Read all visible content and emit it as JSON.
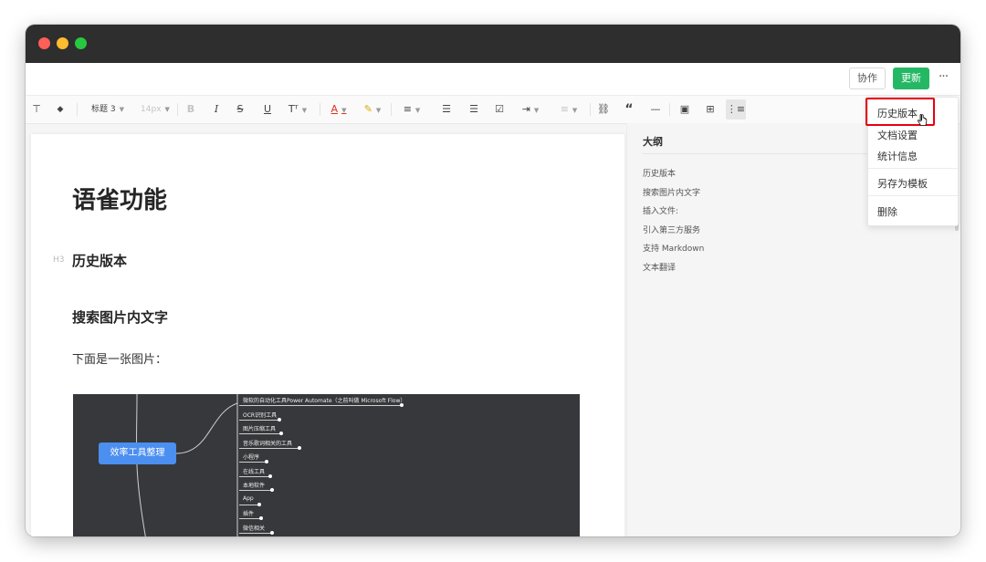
{
  "topbar": {
    "collab_label": "协作",
    "update_label": "更新",
    "more_label": "···"
  },
  "toolbar": {
    "items": [
      {
        "name": "format-painter-icon",
        "glyph": "⊤"
      },
      {
        "name": "eraser-icon",
        "glyph": "◆"
      },
      {
        "name": "heading-select",
        "glyph": "标题 3"
      },
      {
        "name": "font-size-select",
        "glyph": "14px"
      },
      {
        "name": "bold-icon",
        "glyph": "B"
      },
      {
        "name": "italic-icon",
        "glyph": "I"
      },
      {
        "name": "strikethrough-icon",
        "glyph": "S"
      },
      {
        "name": "underline-icon",
        "glyph": "U"
      },
      {
        "name": "superscript-icon",
        "glyph": "Tᵀ"
      },
      {
        "name": "font-color-icon",
        "glyph": "A"
      },
      {
        "name": "highlight-icon",
        "glyph": "✎"
      },
      {
        "name": "align-icon",
        "glyph": "≡"
      },
      {
        "name": "bulleted-list-icon",
        "glyph": "☰"
      },
      {
        "name": "numbered-list-icon",
        "glyph": "☰"
      },
      {
        "name": "checklist-icon",
        "glyph": "☑"
      },
      {
        "name": "indent-icon",
        "glyph": "⇥"
      },
      {
        "name": "line-spacing-icon",
        "glyph": "≡"
      },
      {
        "name": "link-icon",
        "glyph": "⛓"
      },
      {
        "name": "quote-icon",
        "glyph": "“"
      },
      {
        "name": "divider-icon",
        "glyph": "—"
      },
      {
        "name": "insert-card-icon",
        "glyph": "▣"
      },
      {
        "name": "insert-image-icon",
        "glyph": "⊞"
      },
      {
        "name": "outline-toggle-icon",
        "glyph": "⋮≡"
      }
    ]
  },
  "document": {
    "title": "语雀功能",
    "heading_hint": "H3",
    "section1": "历史版本",
    "section2": "搜索图片内文字",
    "paragraph": "下面是一张图片："
  },
  "mindmap": {
    "root": "效率工具整理",
    "nodes": [
      "微软的自动化工具Power Automate（之前叫做 Microsoft Flow）",
      "OCR识别工具",
      "图片压缩工具",
      "音乐歌词相关的工具",
      "小程序",
      "在线工具",
      "本地软件",
      "App",
      "插件",
      "微信相关"
    ]
  },
  "outline": {
    "title": "大纲",
    "items": [
      "历史版本",
      "搜索图片内文字",
      "插入文件:",
      "引入第三方服务",
      "支持 Markdown",
      "文本翻译"
    ]
  },
  "menu": {
    "items": [
      "历史版本",
      "文档设置",
      "统计信息",
      "另存为模板",
      "删除"
    ]
  },
  "colors": {
    "accent_green": "#25b864",
    "highlight_red": "#e60012",
    "mindmap_bg": "#36383b",
    "mindmap_root": "#4b8ff0"
  }
}
